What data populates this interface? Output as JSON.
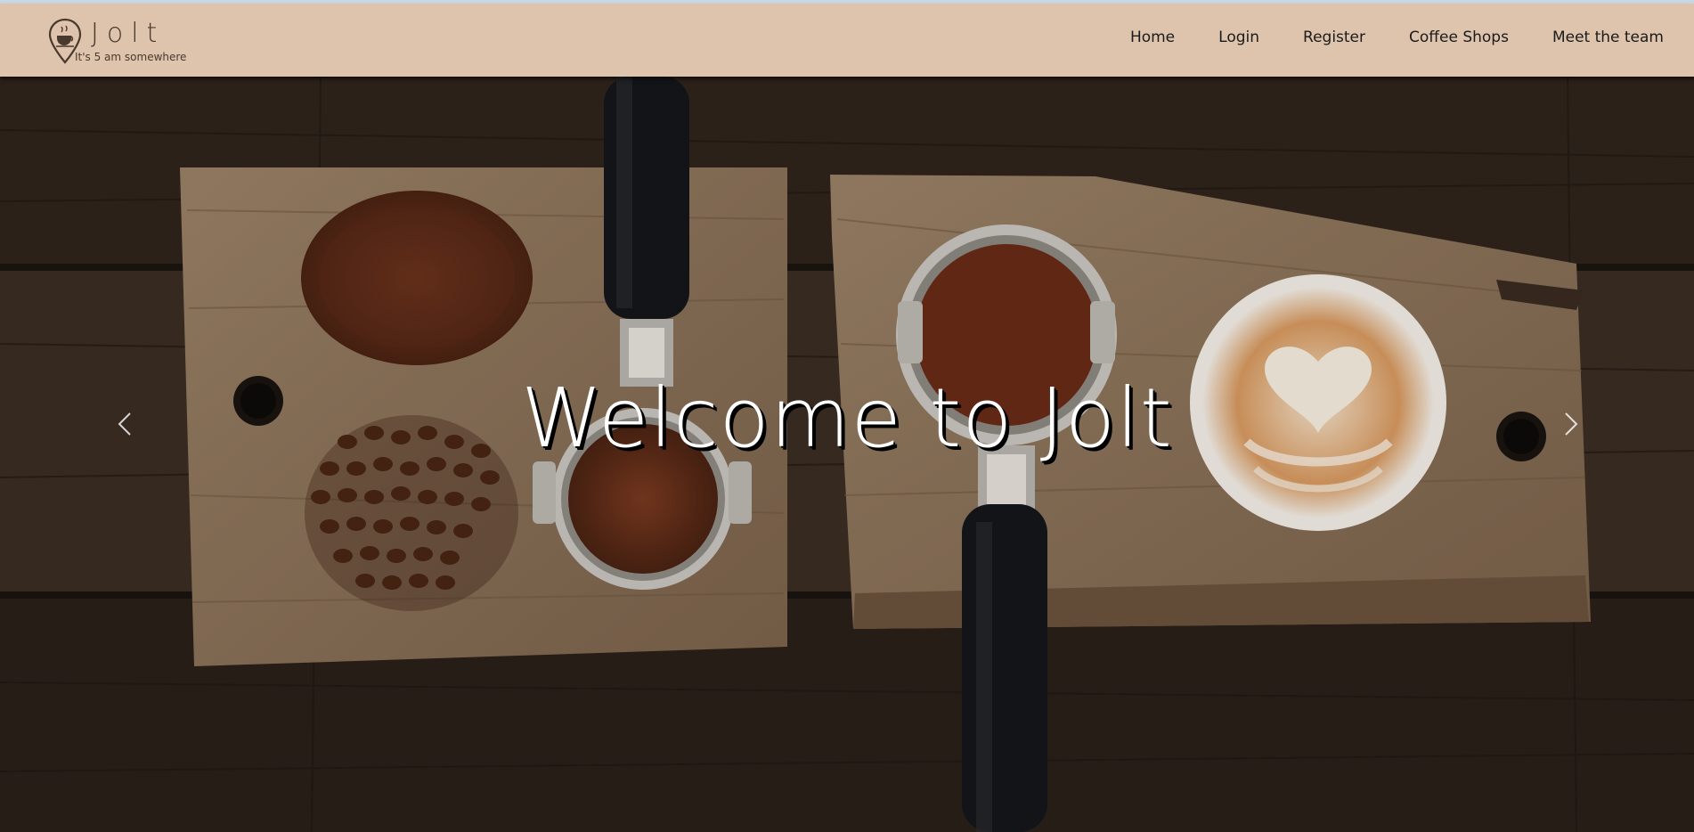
{
  "brand": {
    "name": "Jolt",
    "tagline": "It's 5 am somewhere",
    "logo_icon": "coffee-cup-location-pin-icon"
  },
  "nav": {
    "links": [
      "Home",
      "Login",
      "Register",
      "Coffee Shops",
      "Meet the team"
    ]
  },
  "hero": {
    "title": "Welcome to Jolt",
    "image": "coffee grounds, beans, portafilters and latte art on wooden boards",
    "prev_icon": "chevron-left-icon",
    "next_icon": "chevron-right-icon"
  },
  "colors": {
    "navbar_bg": "#dec3ad",
    "brand_text": "#4a3a2e",
    "title_text": "#ffffff"
  }
}
